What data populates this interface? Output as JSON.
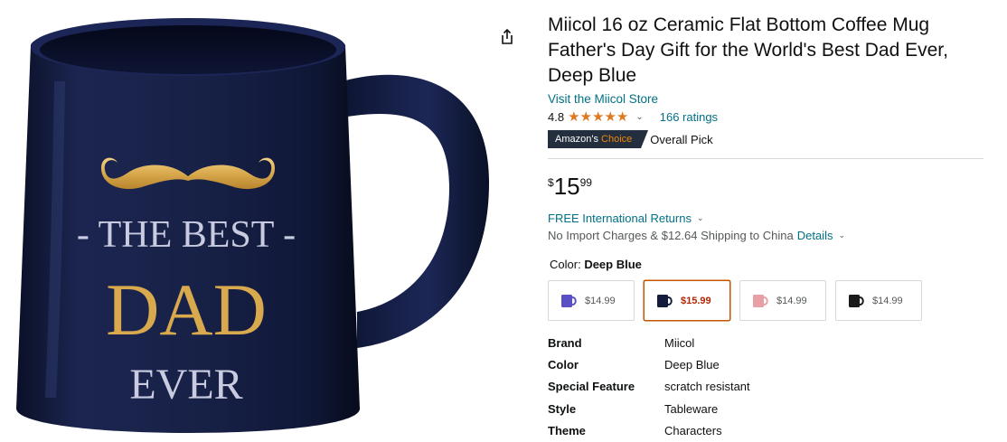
{
  "product": {
    "title": "Miicol 16 oz Ceramic Flat Bottom Coffee Mug Father's Day Gift for the World's Best Dad Ever, Deep Blue",
    "store_link": "Visit the Miicol Store",
    "rating": "4.8",
    "stars": 4.8,
    "ratings_count": "166 ratings",
    "badge_prefix": "Amazon's",
    "badge_choice": "Choice",
    "badge_label": "Overall Pick",
    "price_symbol": "$",
    "price_whole": "15",
    "price_fraction": "99",
    "returns": "FREE International Returns",
    "shipping": "No Import Charges & $12.64 Shipping to China",
    "shipping_details": "Details",
    "color_prefix": "Color:",
    "color_selected": "Deep Blue"
  },
  "mug_image": {
    "line1": "- THE BEST -",
    "line2": "DAD",
    "line3": "EVER",
    "mug_color": "#141c3c",
    "gold": "#d9a94d"
  },
  "swatches": [
    {
      "price": "$14.99",
      "color": "#5a4fc4",
      "selected": false
    },
    {
      "price": "$15.99",
      "color": "#141c3c",
      "selected": true
    },
    {
      "price": "$14.99",
      "color": "#e7a0a5",
      "selected": false
    },
    {
      "price": "$14.99",
      "color": "#1a1a1a",
      "selected": false
    }
  ],
  "specs": [
    {
      "key": "Brand",
      "value": "Miicol"
    },
    {
      "key": "Color",
      "value": "Deep Blue"
    },
    {
      "key": "Special Feature",
      "value": "scratch resistant"
    },
    {
      "key": "Style",
      "value": "Tableware"
    },
    {
      "key": "Theme",
      "value": "Characters"
    }
  ],
  "colors": {
    "link": "#007185",
    "star": "#de7921",
    "badge_bg": "#232f3e",
    "badge_accent": "#f08804",
    "selected_border": "#c45500",
    "selected_price": "#b12704"
  }
}
